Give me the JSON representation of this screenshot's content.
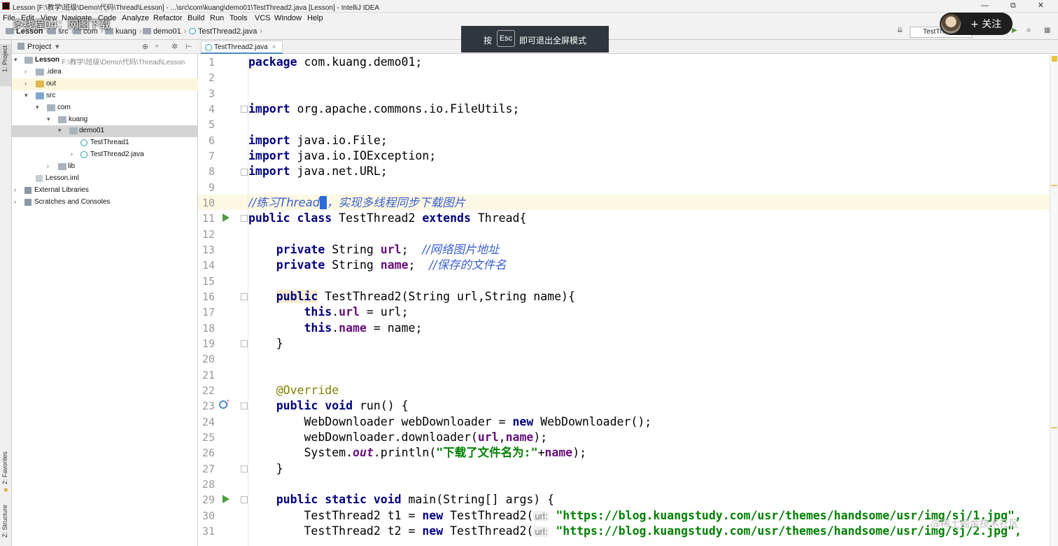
{
  "window": {
    "title": "Lesson [F:\\教学\\班级\\Demo\\代码\\Thread\\Lesson] - ...\\src\\com\\kuang\\demo01\\TestThread2.java [Lesson] - IntelliJ IDEA",
    "controls": "—  ⧉  ✕"
  },
  "video_overlay": {
    "title": "多线程04：网图下载",
    "fullscreen_prefix": "按",
    "fullscreen_key": "Esc",
    "fullscreen_suffix": "即可退出全屏模式",
    "follow_label": "+ 关注",
    "watermark": "@稀土掘金技术社区"
  },
  "menu": [
    "File",
    "Edit",
    "View",
    "Navigate",
    "Code",
    "Analyze",
    "Refactor",
    "Build",
    "Run",
    "Tools",
    "VCS",
    "Window",
    "Help"
  ],
  "breadcrumb": [
    "Lesson",
    "src",
    "com",
    "kuang",
    "demo01",
    "TestThread2.java"
  ],
  "run_config": "TestTh...",
  "side_tools": {
    "project": "1: Project",
    "favorites": "2: Favorites",
    "structure": "Z: Structure"
  },
  "project_panel": {
    "header": "Project",
    "tree": [
      {
        "label": "Lesson",
        "path": "F:\\教学\\班级\\Demo\\代码\\Thread\\Lesson",
        "kind": "module",
        "expanded": true
      },
      {
        "label": ".idea",
        "kind": "folder",
        "expanded": false
      },
      {
        "label": "out",
        "kind": "folder-out",
        "expanded": false
      },
      {
        "label": "src",
        "kind": "folder",
        "expanded": true
      },
      {
        "label": "com",
        "kind": "folder",
        "expanded": true
      },
      {
        "label": "kuang",
        "kind": "folder",
        "expanded": true
      },
      {
        "label": "demo01",
        "kind": "folder",
        "expanded": true,
        "selected": true
      },
      {
        "label": "TestThread1",
        "kind": "class"
      },
      {
        "label": "TestThread2.java",
        "kind": "class",
        "expanded": false
      },
      {
        "label": "lib",
        "kind": "folder",
        "expanded": false
      },
      {
        "label": "Lesson.iml",
        "kind": "file"
      },
      {
        "label": "External Libraries",
        "kind": "ext",
        "expanded": false
      },
      {
        "label": "Scratches and Consoles",
        "kind": "ext",
        "expanded": false
      }
    ]
  },
  "editor": {
    "tab": "TestThread2.java",
    "tab_close": "×",
    "current_line": 10,
    "lines": [
      {
        "n": "1"
      },
      {
        "n": "2"
      },
      {
        "n": "3"
      },
      {
        "n": "4"
      },
      {
        "n": "5"
      },
      {
        "n": "6"
      },
      {
        "n": "7"
      },
      {
        "n": "8"
      },
      {
        "n": "9"
      },
      {
        "n": "10"
      },
      {
        "n": "11"
      },
      {
        "n": "12"
      },
      {
        "n": "13"
      },
      {
        "n": "14"
      },
      {
        "n": "15"
      },
      {
        "n": "16"
      },
      {
        "n": "17"
      },
      {
        "n": "18"
      },
      {
        "n": "19"
      },
      {
        "n": "20"
      },
      {
        "n": "21"
      },
      {
        "n": "22"
      },
      {
        "n": "23"
      },
      {
        "n": "24"
      },
      {
        "n": "25"
      },
      {
        "n": "26"
      },
      {
        "n": "27"
      },
      {
        "n": "28"
      },
      {
        "n": "29"
      },
      {
        "n": "30"
      },
      {
        "n": "31"
      }
    ],
    "code": {
      "l1_kw": "package",
      "l1_rest": " com.kuang.demo01;",
      "l4_kw": "import",
      "l4_rest": " org.apache.commons.io.FileUtils;",
      "l6_kw": "import",
      "l6_rest": " java.io.File;",
      "l7_kw": "import",
      "l7_rest": " java.io.IOException;",
      "l8_kw": "import",
      "l8_rest": " java.net.URL;",
      "l10_a": "//练习Thread",
      "l10_caret": " ",
      "l10_b": "，实现多线程同步下载图片",
      "l11_kw1": "public class",
      "l11_mid": " TestThread2 ",
      "l11_kw2": "extends",
      "l11_rest": " Thread{",
      "l13_kw": "private",
      "l13_type": " String ",
      "l13_fd": "url",
      "l13_rest": ";  ",
      "l13_cm": "//网络图片地址",
      "l14_kw": "private",
      "l14_type": " String ",
      "l14_fd": "name",
      "l14_rest": ";  ",
      "l14_cm": "//保存的文件名",
      "l16_kw": "public",
      "l16_rest": " TestThread2(String url,String name){",
      "l17_kw": "this",
      "l17_dot": ".",
      "l17_fd": "url",
      "l17_rest": " = url;",
      "l18_kw": "this",
      "l18_dot": ".",
      "l18_fd": "name",
      "l18_rest": " = name;",
      "l19": "}",
      "l22": "@Override",
      "l23_kw": "public void",
      "l23_rest": " run() {",
      "l24_a": "WebDownloader webDownloader = ",
      "l24_kw": "new",
      "l24_b": " WebDownloader();",
      "l25_a": "webDownloader.downloader(",
      "l25_fd1": "url",
      "l25_c": ",",
      "l25_fd2": "name",
      "l25_b": ");",
      "l26_a": "System.",
      "l26_it": "out",
      "l26_b": ".println(",
      "l26_st": "\"下载了文件名为:\"",
      "l26_c": "+",
      "l26_fd": "name",
      "l26_d": ");",
      "l27": "}",
      "l29_kw": "public static void",
      "l29_rest": " main(String[] args) {",
      "l30_a": "TestThread2 t1 = ",
      "l30_kw": "new",
      "l30_b": " TestThread2(",
      "l30_hint": "url:",
      "l30_st": " \"https://blog.kuangstudy.com/usr/themes/handsome/usr/img/sj/1.jpg\",",
      "l31_a": "TestThread2 t2 = ",
      "l31_kw": "new",
      "l31_b": " TestThread2(",
      "l31_hint": "url:",
      "l31_st": " \"https://blog.kuangstudy.com/usr/themes/handsome/usr/img/sj/2.jpg\","
    }
  }
}
